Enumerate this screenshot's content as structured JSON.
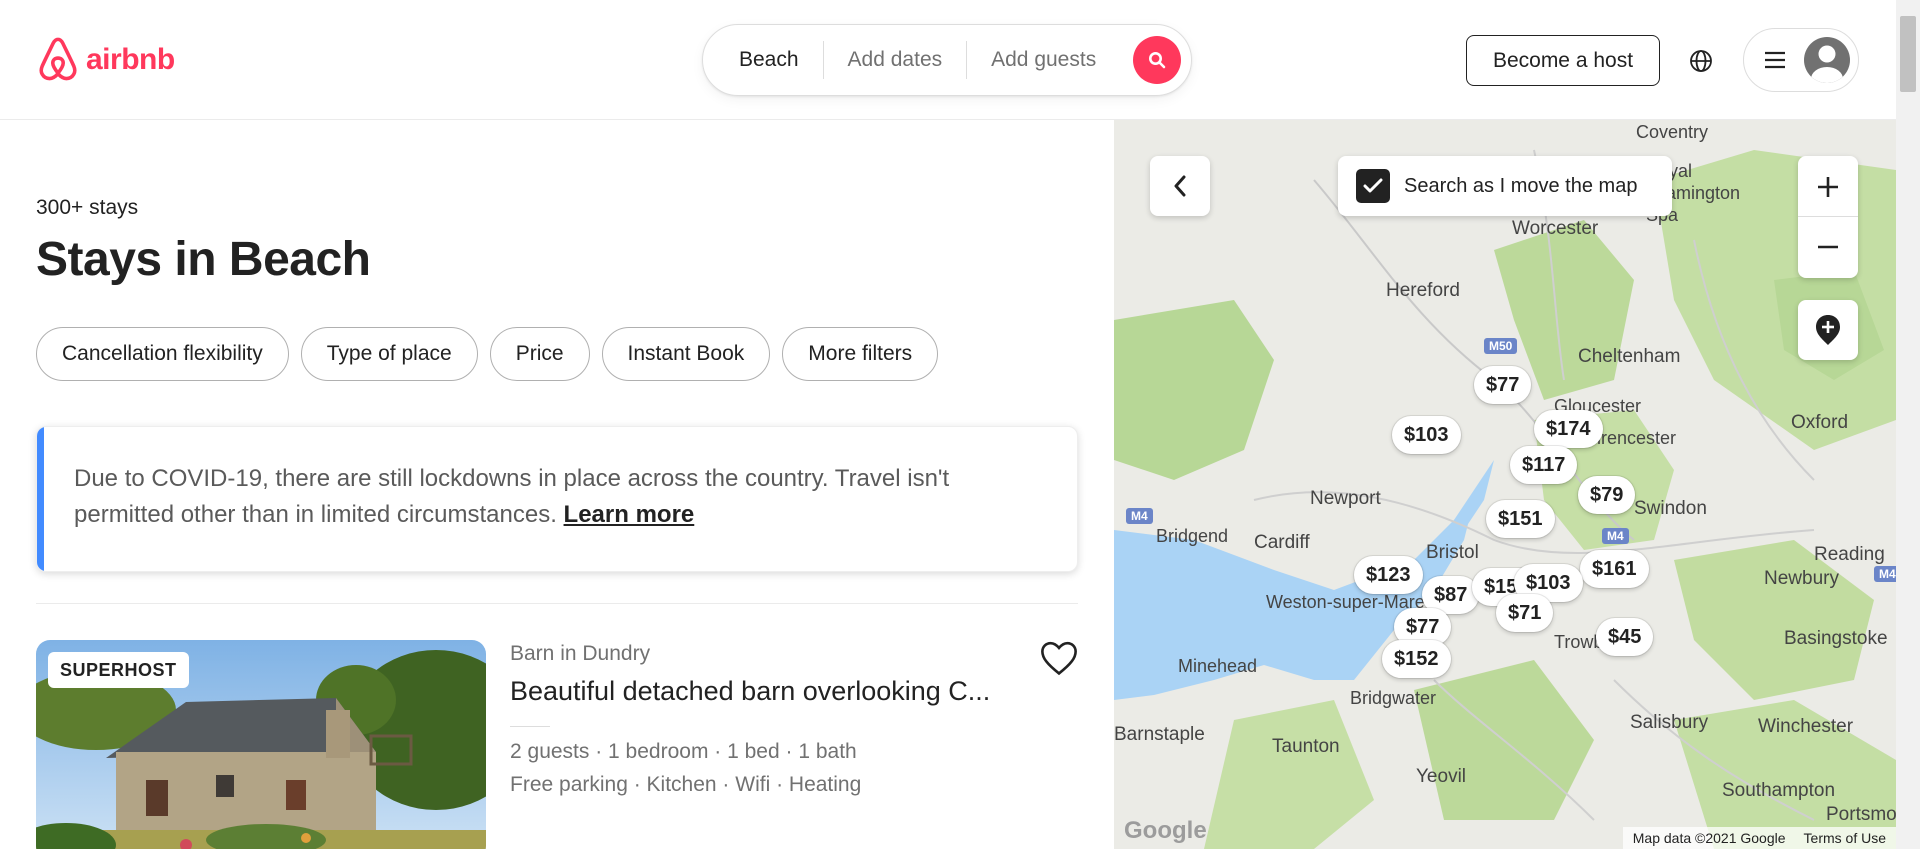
{
  "header": {
    "logo_text": "airbnb",
    "search": {
      "location": "Beach",
      "dates": "Add dates",
      "guests": "Add guests"
    },
    "become_host": "Become a host",
    "brand_color": "#FF385C"
  },
  "results": {
    "count": "300+ stays",
    "title": "Stays in Beach",
    "filters": [
      "Cancellation flexibility",
      "Type of place",
      "Price",
      "Instant Book",
      "More filters"
    ]
  },
  "notice": {
    "text": "Due to COVID-19, there are still lockdowns in place across the country. Travel isn't permitted other than in limited circumstances.",
    "link": "Learn more",
    "accent_color": "#428bff"
  },
  "listing": {
    "badge": "SUPERHOST",
    "subtitle": "Barn in Dundry",
    "title": "Beautiful detached barn overlooking C...",
    "details": "2 guests · 1 bedroom · 1 bed · 1 bath",
    "amenities": "Free parking · Kitchen · Wifi · Heating"
  },
  "map": {
    "search_as_move": "Search as I move the map",
    "search_as_move_checked": true,
    "footer": {
      "data": "Map data ©2021 Google",
      "terms": "Terms of Use"
    },
    "google": "Google",
    "places": [
      "Coventry",
      "Royal Leamington Spa",
      "Worcester",
      "Hereford",
      "Cheltenham",
      "Gloucester",
      "Cirencester",
      "Oxford",
      "Newport",
      "Cardiff",
      "Bridgend",
      "Swindon",
      "Bristol",
      "Reading",
      "Newbury",
      "Weston-super-Mare",
      "Trowbridge",
      "Basingstoke",
      "Minehead",
      "Bridgwater",
      "Salisbury",
      "Winchester",
      "Barnstaple",
      "Taunton",
      "Yeovil",
      "Southampton",
      "Portsmouth"
    ],
    "road_labels": [
      "M50",
      "M4",
      "M4",
      "M4"
    ],
    "prices": [
      "$77",
      "$103",
      "$174",
      "$117",
      "$79",
      "$151",
      "$161",
      "$123",
      "$87",
      "$155",
      "$103",
      "$71",
      "$77",
      "$45",
      "$152"
    ]
  }
}
